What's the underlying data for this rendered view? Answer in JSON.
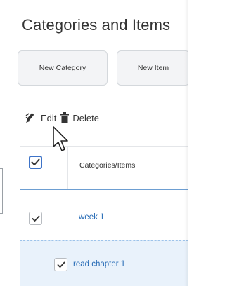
{
  "page": {
    "title": "Categories and Items"
  },
  "buttons": {
    "new_category": "New Category",
    "new_item": "New Item"
  },
  "toolbar": {
    "edit_label": "Edit",
    "edit_icon": "pencil-icon",
    "delete_label": "Delete",
    "delete_icon": "trash-icon"
  },
  "table": {
    "header": "Categories/Items",
    "select_all_checked": true,
    "rows": [
      {
        "label": "week 1",
        "checked": true,
        "kind": "category"
      },
      {
        "label": "read chapter 1",
        "checked": true,
        "kind": "item"
      }
    ]
  },
  "colors": {
    "link": "#1f66b3",
    "accent": "#3d73c8",
    "selected_row_bg": "#e9f2fb"
  }
}
